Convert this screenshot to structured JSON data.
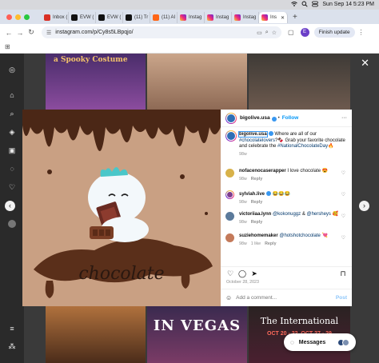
{
  "menubar": {
    "datetime": "Sun Sep 14  5:23 PM"
  },
  "browser": {
    "tabs": [
      {
        "label": "Inbox (",
        "icon": "gmail-icon",
        "color": "#d93025"
      },
      {
        "label": "EVW (",
        "icon": "x-icon",
        "color": "#111111"
      },
      {
        "label": "EVW (",
        "icon": "x-icon",
        "color": "#111111"
      },
      {
        "label": "(11) Tr",
        "icon": "x-icon",
        "color": "#111111"
      },
      {
        "label": "(11) AI",
        "icon": "substack-icon",
        "color": "#ff6719"
      },
      {
        "label": "Instag",
        "icon": "instagram-icon",
        "color": "#e1306c"
      },
      {
        "label": "Instag",
        "icon": "instagram-icon",
        "color": "#e1306c"
      },
      {
        "label": "Instag",
        "icon": "instagram-icon",
        "color": "#e1306c"
      },
      {
        "label": "Ins",
        "icon": "instagram-icon",
        "color": "#e1306c",
        "active": true
      }
    ],
    "url": "instagram.com/p/Cy8s5LBpqjo/",
    "profile_initial": "E",
    "finish_update": "Finish update"
  },
  "post": {
    "author": "bigolive.usa",
    "follow_label": "Follow",
    "caption_line1": "Where are all of our",
    "caption_tag": "#chocolatelovers",
    "caption_line2": "Grab your favorite chocolate and celebrate the",
    "caption_tag2": "#NationalChocolateDay",
    "caption_time": "98w",
    "image_word": "chocolate",
    "date": "October 28, 2023",
    "add_comment_placeholder": "Add a comment...",
    "post_label": "Post",
    "comments": [
      {
        "user": "nofacenocaserapper",
        "text": "I love chocolate 😍",
        "time": "98w",
        "likes": "",
        "reply": "Reply",
        "avatar_color": "#d8b24a"
      },
      {
        "user": "sylviah.live",
        "text": "😂😂😂",
        "time": "98w",
        "likes": "",
        "reply": "Reply",
        "avatar_color": "#7d3d8e"
      },
      {
        "user": "victoriiaa.lynn",
        "text": "& ",
        "tag1": "@kokonuggz",
        "tag2": "@hersheys",
        "emoji": "🥰",
        "time": "98w",
        "likes": "",
        "reply": "Reply",
        "avatar_color": "#5b7a9b"
      },
      {
        "user": "suziehomemaker",
        "tag1": "@hotshotchocolate",
        "emoji": "💘",
        "time": "98w",
        "likes": "1 like",
        "reply": "Reply",
        "avatar_color": "#c47a5a"
      }
    ]
  },
  "messages": {
    "label": "Messages"
  },
  "background_tiles": {
    "costume_text": "a Spooky Costume",
    "vegas_text": "IN VEGAS",
    "intl_text": "The International",
    "dates_text": "OCT 20 - 22, OCT 27 - 29"
  }
}
